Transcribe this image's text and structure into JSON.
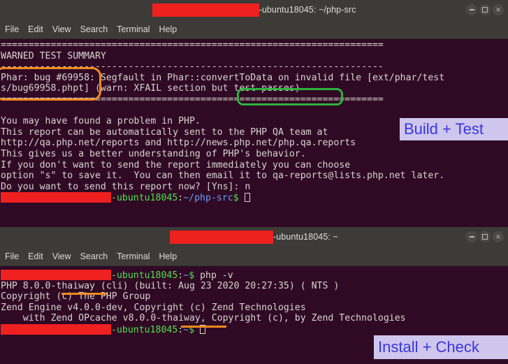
{
  "windows": [
    {
      "id": "build-test-window",
      "title_suffix": "-ubuntu18045: ~/php-src",
      "menu": [
        "File",
        "Edit",
        "View",
        "Search",
        "Terminal",
        "Help"
      ],
      "controls": {
        "minimize": "minimize",
        "maximize": "maximize",
        "close": "close"
      },
      "lines": [
        "=====================================================================",
        "WARNED TEST SUMMARY",
        "---------------------------------------------------------------------",
        "Phar: bug #69958: Segfault in Phar::convertToData on invalid file [ext/phar/test",
        "s/bug69958.phpt] (warn: XFAIL section but test passes)",
        "=====================================================================",
        "",
        "You may have found a problem in PHP.",
        "This report can be automatically sent to the PHP QA team at",
        "http://qa.php.net/reports and http://news.php.net/php.qa.reports",
        "This gives us a better understanding of PHP's behavior.",
        "If you don't want to send the report immediately you can choose",
        "option \"s\" to save it.  You can then email it to qa-reports@lists.php.net later.",
        "Do you want to send this report now? [Yns]: n"
      ],
      "prompt": {
        "host": "-ubuntu18045",
        "colon": ":",
        "path": "~/php-src",
        "dollar": "$",
        "command": ""
      },
      "callout": "Build + Test"
    },
    {
      "id": "install-check-window",
      "title_suffix": "-ubuntu18045: ~",
      "menu": [
        "File",
        "Edit",
        "View",
        "Search",
        "Terminal",
        "Help"
      ],
      "controls": {
        "minimize": "minimize",
        "maximize": "maximize",
        "close": "close"
      },
      "command_prompt": {
        "host": "-ubuntu18045",
        "colon": ":",
        "path": "~",
        "dollar": "$",
        "command": " php -v"
      },
      "lines": [
        "PHP 8.0.0-thaiway (cli) (built: Aug 23 2020 20:27:35) ( NTS )",
        "Copyright (c) The PHP Group",
        "Zend Engine v4.0.0-dev, Copyright (c) Zend Technologies",
        "    with Zend OPcache v8.0.0-thaiway, Copyright (c), by Zend Technologies"
      ],
      "prompt": {
        "host": "-ubuntu18045",
        "colon": ":",
        "path": "~",
        "dollar": "$",
        "command": ""
      },
      "callout": "Install + Check"
    }
  ],
  "annotations": {
    "orange_box_label": "phar-bug-highlight",
    "green_box_label": "but-test-passes-highlight",
    "orange_underline_1_label": "thaiway-version-underline",
    "orange_underline_2_label": "opcache-thaiway-underline"
  },
  "colors": {
    "terminal_bg": "#300a24",
    "chrome_bg": "#3c3b37",
    "redaction": "#ef2020",
    "prompt_green": "#4ee24e",
    "prompt_blue": "#6a9ef5",
    "anno_orange": "#f08a1e",
    "anno_green": "#2cb23c",
    "callout_bg": "#cfc6ee",
    "callout_fg": "#3838d8"
  }
}
